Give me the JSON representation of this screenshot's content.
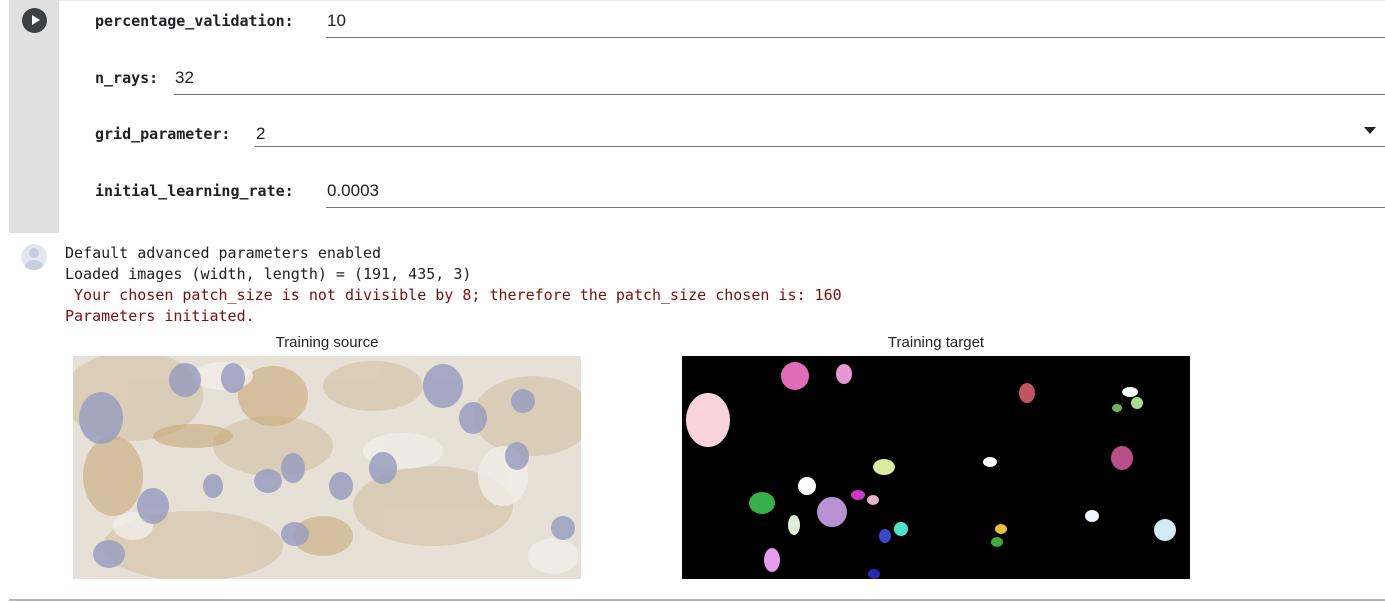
{
  "form": {
    "run_icon": "play-icon",
    "params": [
      {
        "label": "percentage_validation:",
        "value": "10"
      },
      {
        "label": "n_rays:",
        "value": "32"
      },
      {
        "label": "grid_parameter:",
        "value": "2",
        "widget": "dropdown"
      },
      {
        "label": "initial_learning_rate:",
        "value": "0.0003"
      }
    ]
  },
  "output": {
    "icon": "output-avatar-icon",
    "lines": [
      "Default advanced parameters enabled",
      "Loaded images (width, length) = (191, 435, 3)",
      " Your chosen patch_size is not divisible by 8; therefore the patch_size chosen is: 160",
      "Parameters initiated."
    ],
    "colors": {
      "normal": "#202124",
      "warning": "#7a0f0f"
    }
  },
  "figures": {
    "source_title": "Training source",
    "target_title": "Training target"
  }
}
